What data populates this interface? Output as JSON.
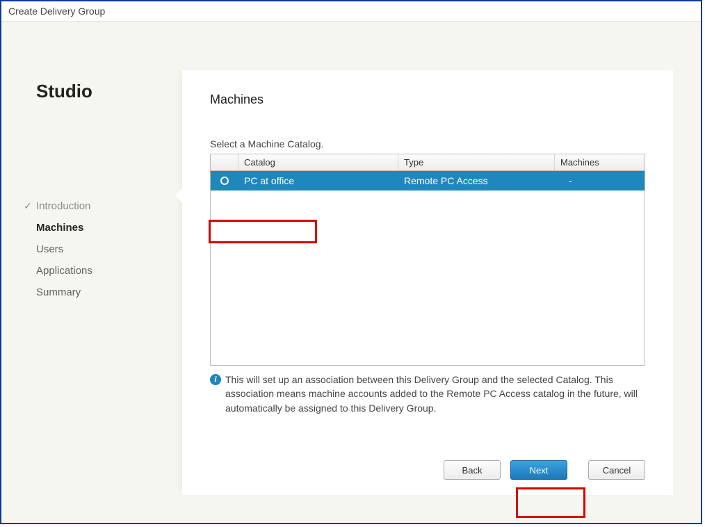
{
  "window": {
    "title": "Create Delivery Group"
  },
  "sidebar": {
    "brand": "Studio",
    "items": [
      {
        "label": "Introduction",
        "state": "completed"
      },
      {
        "label": "Machines",
        "state": "active"
      },
      {
        "label": "Users",
        "state": "pending"
      },
      {
        "label": "Applications",
        "state": "pending"
      },
      {
        "label": "Summary",
        "state": "pending"
      }
    ]
  },
  "page": {
    "heading": "Machines",
    "instruction": "Select a Machine Catalog.",
    "columns": {
      "catalog": "Catalog",
      "type": "Type",
      "machines": "Machines"
    },
    "rows": [
      {
        "catalog": "PC at office",
        "type": "Remote PC Access",
        "machines": "-",
        "selected": true
      }
    ],
    "info": "This will set up an association between this Delivery Group and the selected Catalog. This association means machine accounts added to the Remote PC Access catalog in the future, will automatically be assigned to this Delivery Group."
  },
  "buttons": {
    "back": "Back",
    "next": "Next",
    "cancel": "Cancel"
  }
}
